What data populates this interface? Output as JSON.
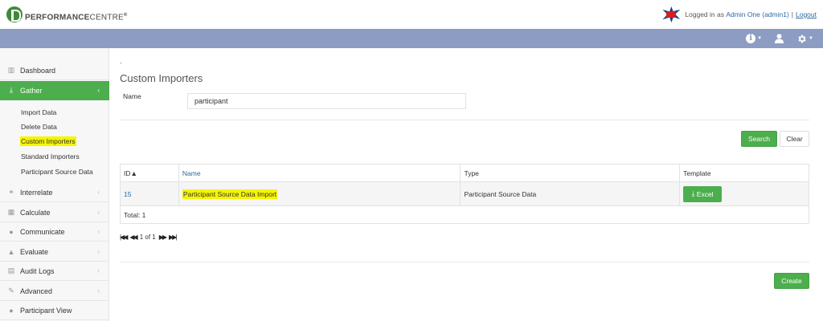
{
  "brand": {
    "name_bold": "PERFORMANCE",
    "name_light": "CENTRE",
    "mark": "®"
  },
  "user": {
    "logged_in_prefix": "Logged in as",
    "user_name": "Admin One (admin1)",
    "separator": "|",
    "logout": "Logout"
  },
  "nav_icons": [
    "info-icon",
    "user-icon",
    "gear-icon"
  ],
  "sidebar": {
    "items": [
      {
        "label": "Dashboard",
        "icon": "chart-icon"
      },
      {
        "label": "Gather",
        "icon": "download-icon",
        "active": true
      },
      {
        "label": "Interrelate",
        "icon": "link-icon"
      },
      {
        "label": "Calculate",
        "icon": "table-icon"
      },
      {
        "label": "Communicate",
        "icon": "comments-icon"
      },
      {
        "label": "Evaluate",
        "icon": "thumbs-up-icon"
      },
      {
        "label": "Audit Logs",
        "icon": "file-icon"
      },
      {
        "label": "Advanced",
        "icon": "wrench-icon"
      },
      {
        "label": "Participant View",
        "icon": "user-icon"
      }
    ],
    "gather_sub": [
      "Import Data",
      "Delete Data",
      "Custom Importers",
      "Standard Importers",
      "Participant Source Data"
    ]
  },
  "main": {
    "breadcrumb_dot": "-",
    "title": "Custom Importers",
    "filter": {
      "label": "Name",
      "value": "participant"
    },
    "search_label": "Search",
    "clear_label": "Clear",
    "table": {
      "headers": [
        "ID▲",
        "Name",
        "Type",
        "Template"
      ],
      "rows": [
        {
          "id": "15",
          "name": "Participant Source Data Import",
          "type": "Participant Source Data",
          "template": "Excel"
        }
      ],
      "total": "Total: 1"
    },
    "pager": {
      "text": "1 of 1"
    },
    "create_label": "Create"
  },
  "colors": {
    "accent_green": "#4cae4c",
    "nav_strip": "#8c9cc3",
    "highlight": "#f5f500",
    "link": "#2c6aa0"
  }
}
